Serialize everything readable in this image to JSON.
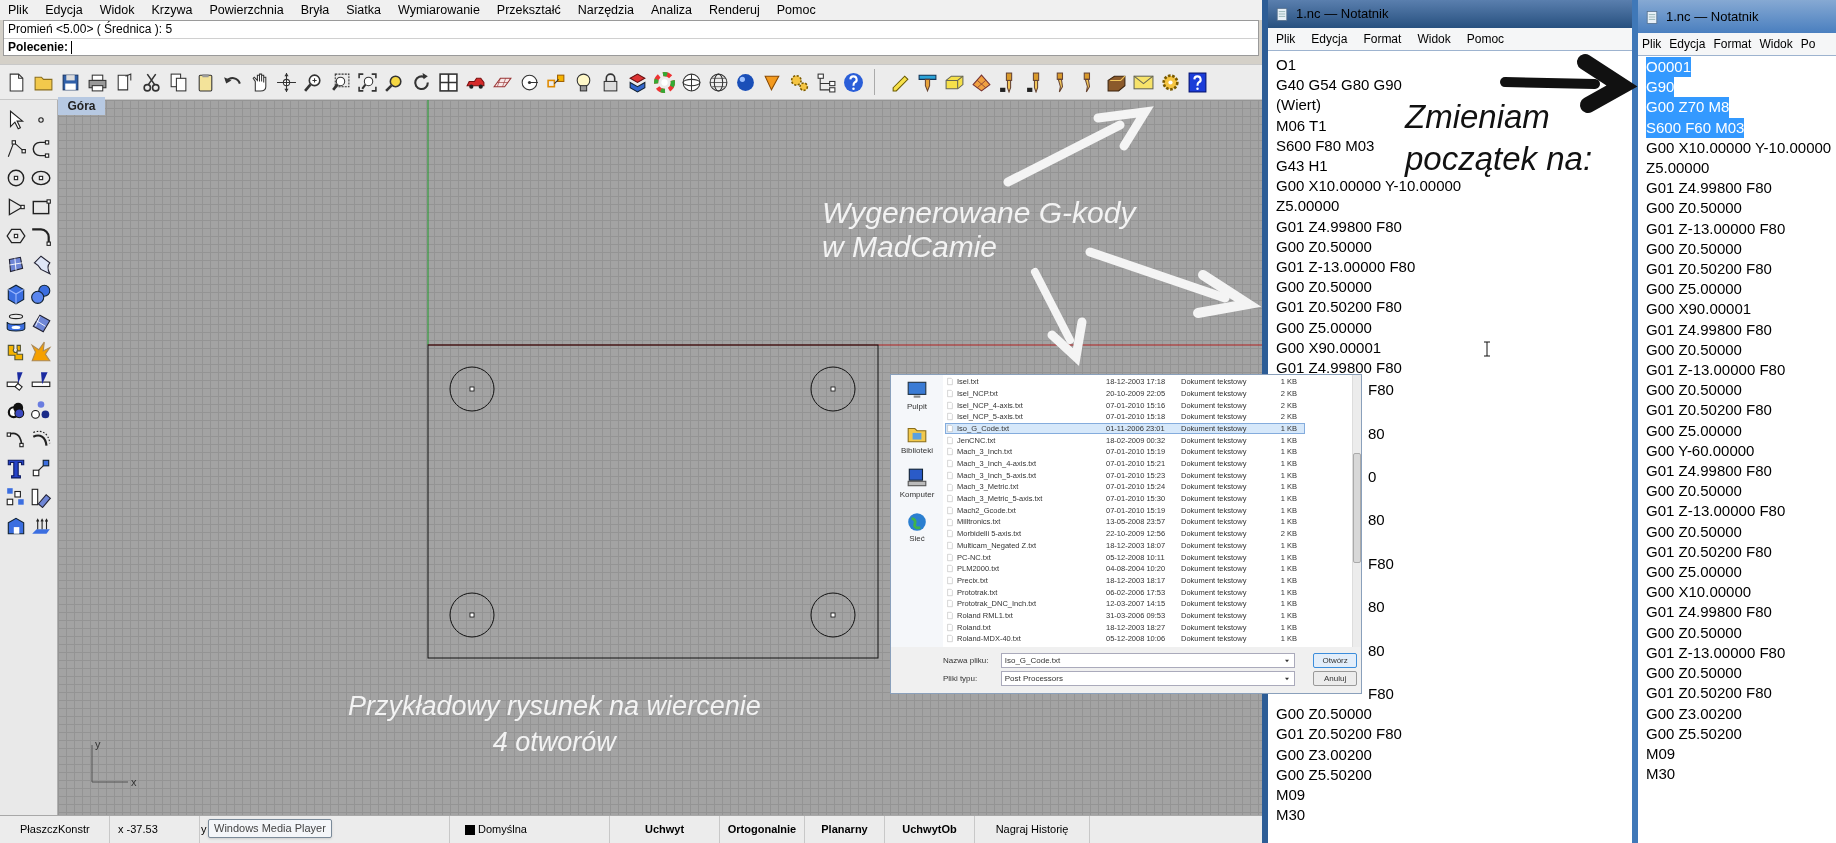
{
  "menu_bar": [
    "Plik",
    "Edycja",
    "Widok",
    "Krzywa",
    "Powierzchnia",
    "Bryła",
    "Siatka",
    "Wymiarowanie",
    "Przekształć",
    "Narzędzia",
    "Analiza",
    "Renderuj",
    "Pomoc"
  ],
  "command_history": "Promień <5.00> ( Średnica ): 5",
  "command_label": "Polecenie:",
  "viewport": {
    "title": "Góra",
    "axis_labels": [
      "y",
      "x"
    ]
  },
  "annotations": [
    {
      "kind": "light",
      "lines": [
        "Wygenerowane G-kody",
        "w MadCamie"
      ]
    },
    {
      "kind": "dark",
      "lines": [
        "Zmieniam",
        "początek na:"
      ]
    },
    {
      "kind": "light",
      "lines": [
        "Przykładowy rysunek na wiercenie",
        "4 otworów"
      ]
    }
  ],
  "file_dialog": {
    "places": [
      "Pulpit",
      "Biblioteki",
      "Komputer",
      "Sieć"
    ],
    "files": [
      {
        "name": "Isel.txt",
        "date": "18-12-2003 17:18",
        "type": "Dokument tekstowy",
        "size": "1 KB",
        "selected": false
      },
      {
        "name": "Isel_NCP.txt",
        "date": "20-10-2009 22:05",
        "type": "Dokument tekstowy",
        "size": "2 KB",
        "selected": false
      },
      {
        "name": "Isel_NCP_4-axis.txt",
        "date": "07-01-2010 15:16",
        "type": "Dokument tekstowy",
        "size": "2 KB",
        "selected": false
      },
      {
        "name": "Isel_NCP_5-axis.txt",
        "date": "07-01-2010 15:18",
        "type": "Dokument tekstowy",
        "size": "2 KB",
        "selected": false
      },
      {
        "name": "Iso_G_Code.txt",
        "date": "01-11-2006 23:01",
        "type": "Dokument tekstowy",
        "size": "1 KB",
        "selected": true
      },
      {
        "name": "JenCNC.txt",
        "date": "18-02-2009 00:32",
        "type": "Dokument tekstowy",
        "size": "1 KB",
        "selected": false
      },
      {
        "name": "Mach_3_Inch.txt",
        "date": "07-01-2010 15:19",
        "type": "Dokument tekstowy",
        "size": "1 KB",
        "selected": false
      },
      {
        "name": "Mach_3_Inch_4-axis.txt",
        "date": "07-01-2010 15:21",
        "type": "Dokument tekstowy",
        "size": "1 KB",
        "selected": false
      },
      {
        "name": "Mach_3_Inch_5-axis.txt",
        "date": "07-01-2010 15:23",
        "type": "Dokument tekstowy",
        "size": "1 KB",
        "selected": false
      },
      {
        "name": "Mach_3_Metric.txt",
        "date": "07-01-2010 15:24",
        "type": "Dokument tekstowy",
        "size": "1 KB",
        "selected": false
      },
      {
        "name": "Mach_3_Metric_5-axis.txt",
        "date": "07-01-2010 15:30",
        "type": "Dokument tekstowy",
        "size": "1 KB",
        "selected": false
      },
      {
        "name": "Mach2_Gcode.txt",
        "date": "07-01-2010 15:19",
        "type": "Dokument tekstowy",
        "size": "1 KB",
        "selected": false
      },
      {
        "name": "Milltronics.txt",
        "date": "13-05-2008 23:57",
        "type": "Dokument tekstowy",
        "size": "1 KB",
        "selected": false
      },
      {
        "name": "Morbidelli 5-axis.txt",
        "date": "22-10-2009 12:56",
        "type": "Dokument tekstowy",
        "size": "2 KB",
        "selected": false
      },
      {
        "name": "Multicam_Negated Z.txt",
        "date": "18-12-2003 18:07",
        "type": "Dokument tekstowy",
        "size": "1 KB",
        "selected": false
      },
      {
        "name": "PC-NC.txt",
        "date": "05-12-2008 10:11",
        "type": "Dokument tekstowy",
        "size": "1 KB",
        "selected": false
      },
      {
        "name": "PLM2000.txt",
        "date": "04-08-2004 10:20",
        "type": "Dokument tekstowy",
        "size": "1 KB",
        "selected": false
      },
      {
        "name": "Precix.txt",
        "date": "18-12-2003 18:17",
        "type": "Dokument tekstowy",
        "size": "1 KB",
        "selected": false
      },
      {
        "name": "Prototrak.txt",
        "date": "06-02-2006 17:53",
        "type": "Dokument tekstowy",
        "size": "1 KB",
        "selected": false
      },
      {
        "name": "Prototrak_DNC_Inch.txt",
        "date": "12-03-2007 14:15",
        "type": "Dokument tekstowy",
        "size": "1 KB",
        "selected": false
      },
      {
        "name": "Roland RML1.txt",
        "date": "31-03-2006 09:53",
        "type": "Dokument tekstowy",
        "size": "1 KB",
        "selected": false
      },
      {
        "name": "Roland.txt",
        "date": "18-12-2003 18:27",
        "type": "Dokument tekstowy",
        "size": "1 KB",
        "selected": false
      },
      {
        "name": "Roland-MDX-40.txt",
        "date": "05-12-2008 10:06",
        "type": "Dokument tekstowy",
        "size": "1 KB",
        "selected": false
      }
    ],
    "file_name_label": "Nazwa pliku:",
    "file_name": "Iso_G_Code.txt",
    "file_type_label": "Pliki typu:",
    "file_type": "Post Processors",
    "buttons": [
      {
        "label": "Otwórz",
        "kind": "primary"
      },
      {
        "label": "Anuluj",
        "kind": "normal"
      }
    ]
  },
  "status_bar": {
    "items": [
      {
        "kind": "plain",
        "text": "PłaszczKonstr"
      },
      {
        "kind": "plain",
        "text": "x -37.53"
      },
      {
        "kind": "plain",
        "text": "y"
      },
      {
        "kind": "layer",
        "text": "Domyślna"
      },
      {
        "kind": "toggle",
        "text": "Uchwyt",
        "on": true
      },
      {
        "kind": "toggle",
        "text": "Ortogonalnie",
        "on": true
      },
      {
        "kind": "toggle",
        "text": "Planarny",
        "on": true
      },
      {
        "kind": "toggle",
        "text": "UchwytOb",
        "on": true
      },
      {
        "kind": "toggle",
        "text": "Nagraj Historię",
        "on": false
      }
    ],
    "tooltip": "Windows Media Player"
  },
  "notepads": [
    {
      "title": "1.nc — Notatnik",
      "menu": [
        "Plik",
        "Edycja",
        "Format",
        "Widok",
        "Pomoc"
      ],
      "lines": [
        {
          "kind": "full",
          "text": "O1"
        },
        {
          "kind": "full",
          "text": "G40 G54 G80 G90"
        },
        {
          "kind": "full",
          "text": "(Wiert)"
        },
        {
          "kind": "full",
          "text": "M06 T1"
        },
        {
          "kind": "full",
          "text": "S600 F80 M03"
        },
        {
          "kind": "full",
          "text": "G43 H1"
        },
        {
          "kind": "full",
          "text": "G00 X10.00000 Y-10.00000"
        },
        {
          "kind": "full",
          "text": "Z5.00000"
        },
        {
          "kind": "full",
          "text": "G01 Z4.99800 F80"
        },
        {
          "kind": "full",
          "text": "G00 Z0.50000"
        },
        {
          "kind": "full",
          "text": "G01 Z-13.00000 F80"
        },
        {
          "kind": "full",
          "text": "G00 Z0.50000"
        },
        {
          "kind": "full",
          "text": "G01 Z0.50200 F80"
        },
        {
          "kind": "full",
          "text": "G00 Z5.00000"
        },
        {
          "kind": "full",
          "text": "G00 X90.00001"
        },
        {
          "kind": "full",
          "text": "G01 Z4.99800 F80"
        },
        {
          "kind": "fragment",
          "text": "F80"
        },
        {
          "kind": "fragment",
          "text": "80"
        },
        {
          "kind": "fragment",
          "text": "0"
        },
        {
          "kind": "fragment",
          "text": "80"
        },
        {
          "kind": "fragment",
          "text": "F80"
        },
        {
          "kind": "fragment",
          "text": "80"
        },
        {
          "kind": "fragment",
          "text": "80"
        },
        {
          "kind": "fragment",
          "text": "F80"
        },
        {
          "kind": "full",
          "text": "G00 Z0.50000"
        },
        {
          "kind": "full",
          "text": "G01 Z0.50200 F80"
        },
        {
          "kind": "full",
          "text": "G00 Z3.00200"
        },
        {
          "kind": "full",
          "text": "G00 Z5.50200"
        },
        {
          "kind": "full",
          "text": "M09"
        },
        {
          "kind": "full",
          "text": "M30"
        }
      ]
    },
    {
      "title": "1.nc — Notatnik",
      "menu": [
        "Plik",
        "Edycja",
        "Format",
        "Widok",
        "Po"
      ],
      "lines": [
        {
          "kind": "full",
          "text": "O0001",
          "selected": true
        },
        {
          "kind": "full",
          "text": "G90",
          "selected": true
        },
        {
          "kind": "full",
          "text": "G00 Z70 M8",
          "selected": true
        },
        {
          "kind": "full",
          "text": "S600 F60 M03",
          "selected": true
        },
        {
          "kind": "full",
          "text": "G00 X10.00000 Y-10.00000",
          "selected": false
        },
        {
          "kind": "full",
          "text": "Z5.00000",
          "selected": false
        },
        {
          "kind": "full",
          "text": "G01 Z4.99800 F80",
          "selected": false
        },
        {
          "kind": "full",
          "text": "G00 Z0.50000",
          "selected": false
        },
        {
          "kind": "full",
          "text": "G01 Z-13.00000 F80",
          "selected": false
        },
        {
          "kind": "full",
          "text": "G00 Z0.50000",
          "selected": false
        },
        {
          "kind": "full",
          "text": "G01 Z0.50200 F80",
          "selected": false
        },
        {
          "kind": "full",
          "text": "G00 Z5.00000",
          "selected": false
        },
        {
          "kind": "full",
          "text": "G00 X90.00001",
          "selected": false
        },
        {
          "kind": "full",
          "text": "G01 Z4.99800 F80",
          "selected": false
        },
        {
          "kind": "full",
          "text": "G00 Z0.50000",
          "selected": false
        },
        {
          "kind": "full",
          "text": "G01 Z-13.00000 F80",
          "selected": false
        },
        {
          "kind": "full",
          "text": "G00 Z0.50000",
          "selected": false
        },
        {
          "kind": "full",
          "text": "G01 Z0.50200 F80",
          "selected": false
        },
        {
          "kind": "full",
          "text": "G00 Z5.00000",
          "selected": false
        },
        {
          "kind": "full",
          "text": "G00 Y-60.00000",
          "selected": false
        },
        {
          "kind": "full",
          "text": "G01 Z4.99800 F80",
          "selected": false
        },
        {
          "kind": "full",
          "text": "G00 Z0.50000",
          "selected": false
        },
        {
          "kind": "full",
          "text": "G01 Z-13.00000 F80",
          "selected": false
        },
        {
          "kind": "full",
          "text": "G00 Z0.50000",
          "selected": false
        },
        {
          "kind": "full",
          "text": "G01 Z0.50200 F80",
          "selected": false
        },
        {
          "kind": "full",
          "text": "G00 Z5.00000",
          "selected": false
        },
        {
          "kind": "full",
          "text": "G00 X10.00000",
          "selected": false
        },
        {
          "kind": "full",
          "text": "G01 Z4.99800 F80",
          "selected": false
        },
        {
          "kind": "full",
          "text": "G00 Z0.50000",
          "selected": false
        },
        {
          "kind": "full",
          "text": "G01 Z-13.00000 F80",
          "selected": false
        },
        {
          "kind": "full",
          "text": "G00 Z0.50000",
          "selected": false
        },
        {
          "kind": "full",
          "text": "G01 Z0.50200 F80",
          "selected": false
        },
        {
          "kind": "full",
          "text": "G00 Z3.00200",
          "selected": false
        },
        {
          "kind": "full",
          "text": "G00 Z5.50200",
          "selected": false
        },
        {
          "kind": "full",
          "text": "M09",
          "selected": false
        },
        {
          "kind": "full",
          "text": "M30",
          "selected": false
        }
      ]
    }
  ]
}
